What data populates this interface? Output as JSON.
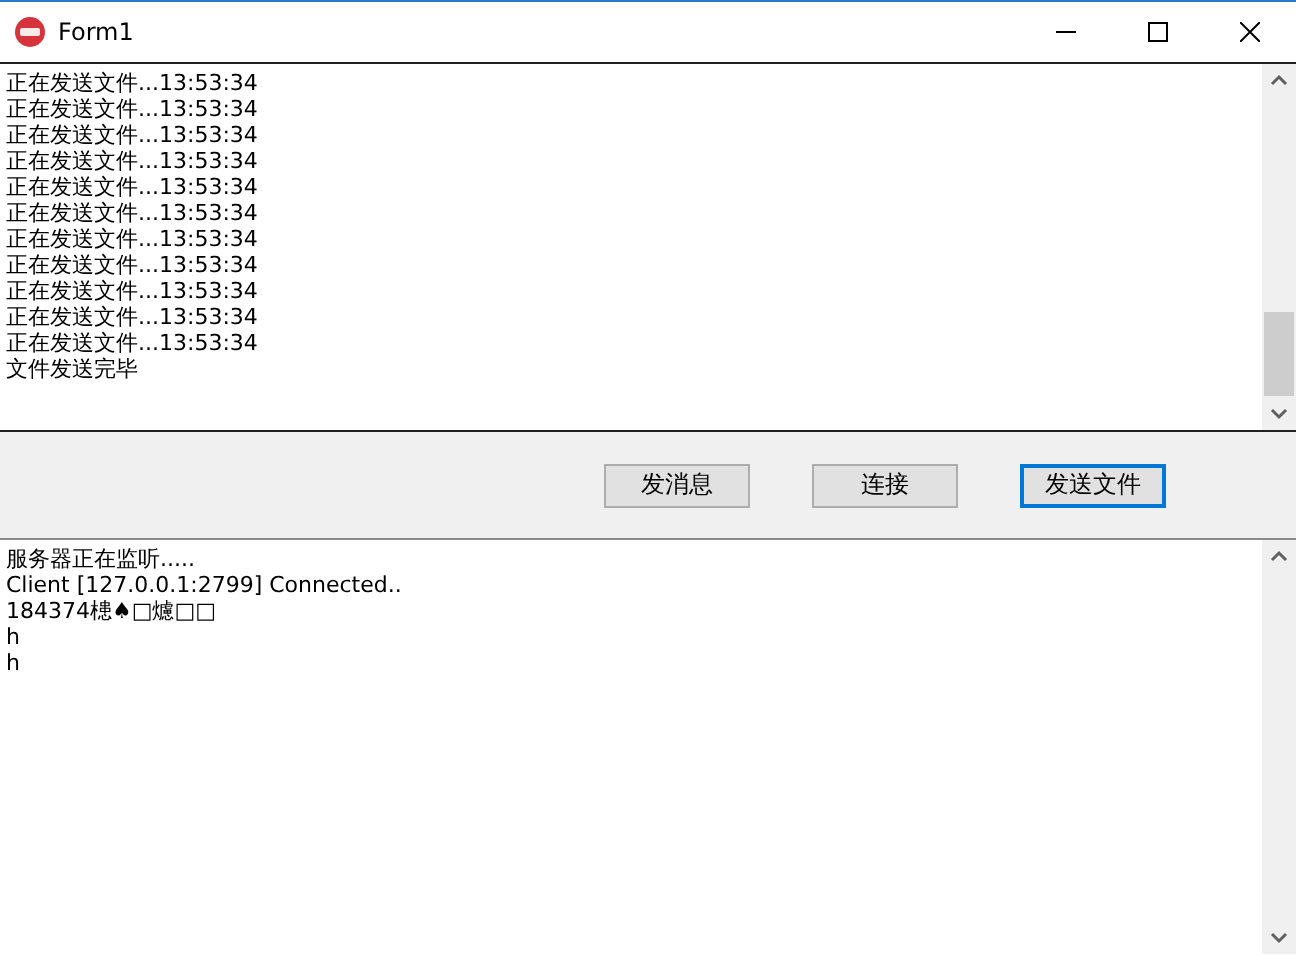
{
  "window": {
    "title": "Form1"
  },
  "send_log": {
    "lines": [
      "正在发送文件...13:53:34",
      "正在发送文件...13:53:34",
      "正在发送文件...13:53:34",
      "正在发送文件...13:53:34",
      "正在发送文件...13:53:34",
      "正在发送文件...13:53:34",
      "正在发送文件...13:53:34",
      "正在发送文件...13:53:34",
      "正在发送文件...13:53:34",
      "正在发送文件...13:53:34",
      "正在发送文件...13:53:34",
      "文件发送完毕"
    ]
  },
  "buttons": [
    {
      "label": "发消息",
      "focused": false
    },
    {
      "label": "连接",
      "focused": false
    },
    {
      "label": "发送文件",
      "focused": true
    }
  ],
  "server_log": {
    "lines": [
      "服务器正在监听.....",
      "Client [127.0.0.1:2799] Connected..",
      "184374槵♠□爈□□",
      "h",
      "h"
    ]
  }
}
